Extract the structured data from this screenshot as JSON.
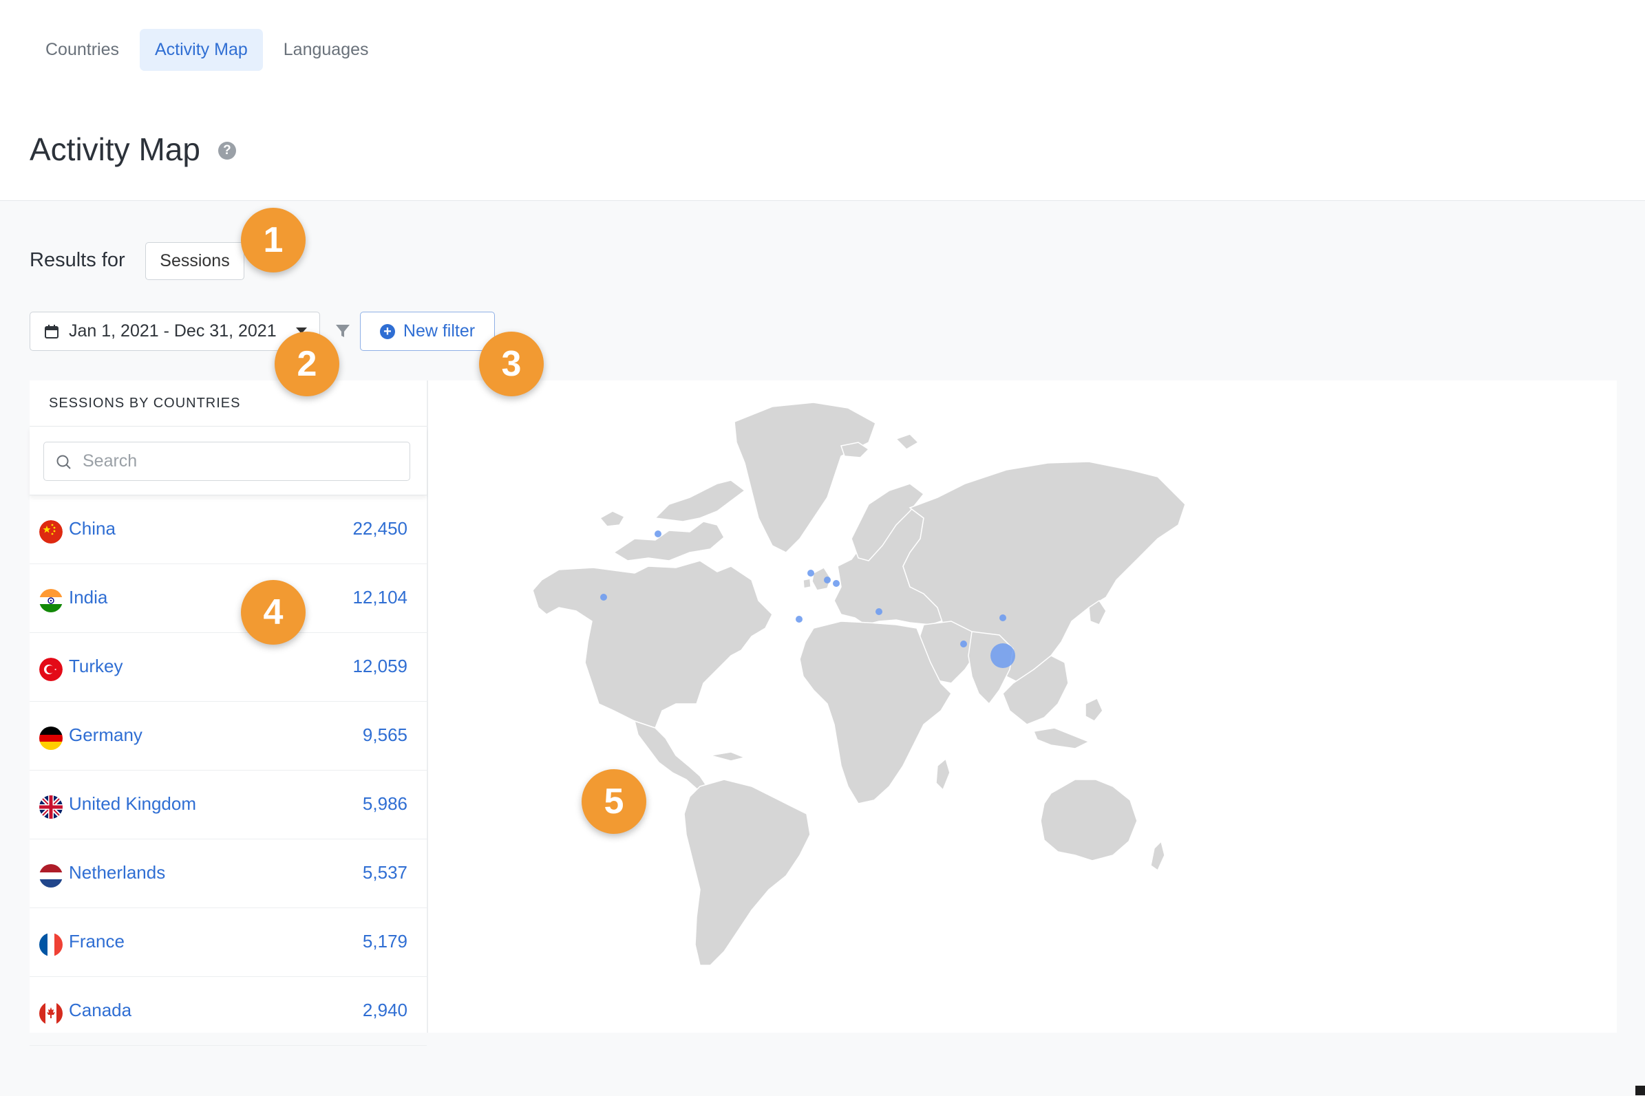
{
  "tabs": [
    {
      "label": "Countries"
    },
    {
      "label": "Activity Map"
    },
    {
      "label": "Languages"
    }
  ],
  "page": {
    "title": "Activity Map",
    "help_icon": "help-icon"
  },
  "controls": {
    "results_for_label": "Results for",
    "metric_value": "Sessions",
    "date_range": "Jan 1, 2021 - Dec 31, 2021",
    "new_filter_label": "New filter"
  },
  "panel": {
    "header": "SESSIONS BY COUNTRIES",
    "search_placeholder": "Search",
    "rows": [
      {
        "country": "China",
        "count": "22,450"
      },
      {
        "country": "India",
        "count": "12,104"
      },
      {
        "country": "Turkey",
        "count": "12,059"
      },
      {
        "country": "Germany",
        "count": "9,565"
      },
      {
        "country": "United Kingdom",
        "count": "5,986"
      },
      {
        "country": "Netherlands",
        "count": "5,537"
      },
      {
        "country": "France",
        "count": "5,179"
      },
      {
        "country": "Canada",
        "count": "2,940"
      }
    ]
  },
  "badges": [
    "1",
    "2",
    "3",
    "4",
    "5"
  ],
  "colors": {
    "accent": "#2f6ed3",
    "badge": "#f29a32",
    "land": "#d6d6d6",
    "marker": "#6f9cf0"
  }
}
